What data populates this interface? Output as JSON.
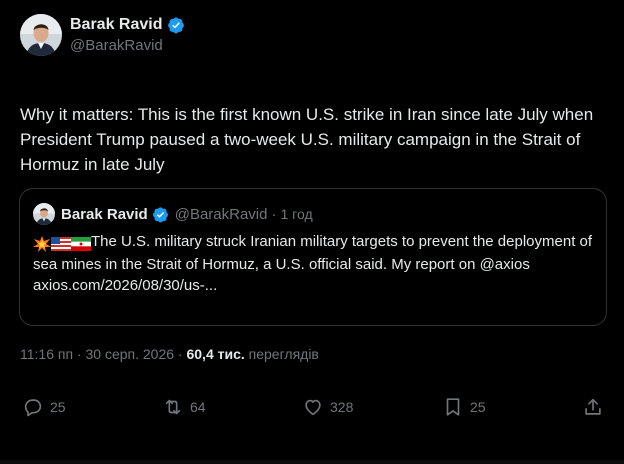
{
  "author": {
    "display_name": "Barak Ravid",
    "handle": "@BarakRavid",
    "verified_icon": "verified-badge-icon",
    "avatar_icon": "avatar"
  },
  "tweet": {
    "text": "Why it matters: This is the first known U.S. strike in Iran since late July when President Trump paused a two-week U.S. military campaign in the Strait of Hormuz in late July"
  },
  "quote": {
    "display_name": "Barak Ravid",
    "handle": "@BarakRavid",
    "separator": "·",
    "time": "1 год",
    "text": "The U.S. military struck Iranian military targets to prevent the deployment of sea mines in the Strait of Hormuz, a U.S. official said. My report on @axios",
    "link": "axios.com/2026/08/30/us-...",
    "emojis": [
      "collision-icon",
      "us-flag-icon",
      "iran-flag-icon"
    ]
  },
  "meta": {
    "timestamp": "11:16 пп · 30 серп. 2026",
    "separator": "·",
    "views_count": "60,4 тис.",
    "views_label": "переглядів"
  },
  "actions": {
    "replies": "25",
    "retweets": "64",
    "likes": "328",
    "bookmarks": "25"
  },
  "colors": {
    "background": "#000000",
    "text": "#e7e9ea",
    "secondary": "#71767b",
    "border": "#2f3336",
    "verified": "#1d9bf0"
  }
}
